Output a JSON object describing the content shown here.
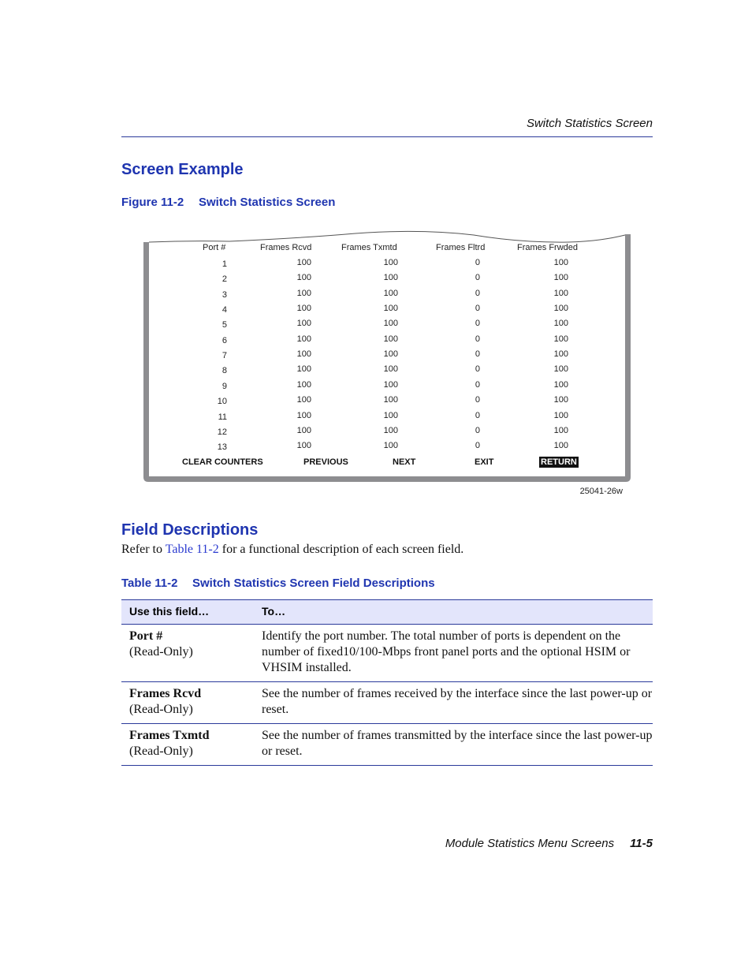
{
  "running_head": "Switch Statistics Screen",
  "section1": {
    "heading": "Screen Example",
    "figure_number": "Figure 11-2",
    "figure_title": "Switch Statistics Screen"
  },
  "screen": {
    "columns": [
      "Port #",
      "Frames Rcvd",
      "Frames Txmtd",
      "Frames Fltrd",
      "Frames Frwded"
    ],
    "rows": [
      [
        "1",
        "100",
        "100",
        "0",
        "100"
      ],
      [
        "2",
        "100",
        "100",
        "0",
        "100"
      ],
      [
        "3",
        "100",
        "100",
        "0",
        "100"
      ],
      [
        "4",
        "100",
        "100",
        "0",
        "100"
      ],
      [
        "5",
        "100",
        "100",
        "0",
        "100"
      ],
      [
        "6",
        "100",
        "100",
        "0",
        "100"
      ],
      [
        "7",
        "100",
        "100",
        "0",
        "100"
      ],
      [
        "8",
        "100",
        "100",
        "0",
        "100"
      ],
      [
        "9",
        "100",
        "100",
        "0",
        "100"
      ],
      [
        "10",
        "100",
        "100",
        "0",
        "100"
      ],
      [
        "11",
        "100",
        "100",
        "0",
        "100"
      ],
      [
        "12",
        "100",
        "100",
        "0",
        "100"
      ],
      [
        "13",
        "100",
        "100",
        "0",
        "100"
      ]
    ],
    "commands": [
      {
        "label": "CLEAR COUNTERS",
        "selected": false
      },
      {
        "label": "PREVIOUS",
        "selected": false
      },
      {
        "label": "NEXT",
        "selected": false
      },
      {
        "label": "EXIT",
        "selected": false
      },
      {
        "label": "RETURN",
        "selected": true
      }
    ],
    "figure_id": "25041-26w"
  },
  "section2": {
    "heading": "Field Descriptions",
    "para_before": "Refer to ",
    "para_link": "Table 11-2",
    "para_after": " for a functional description of each screen field.",
    "table_number": "Table 11-2",
    "table_title": "Switch Statistics Screen Field Descriptions"
  },
  "desc_table": {
    "headers": [
      "Use this field…",
      "To…"
    ],
    "rows": [
      {
        "field": "Port #",
        "note": "(Read-Only)",
        "desc": "Identify the port number. The total number of ports is dependent on the number of fixed10/100-Mbps front panel ports and the optional HSIM or VHSIM installed."
      },
      {
        "field": "Frames Rcvd",
        "note": "(Read-Only)",
        "desc": "See the number of frames received by the interface since the last power-up or reset."
      },
      {
        "field": "Frames Txmtd",
        "note": "(Read-Only)",
        "desc": "See the number of frames transmitted by the interface since the last power-up or reset."
      }
    ]
  },
  "footer": {
    "title": "Module Statistics Menu Screens",
    "page": "11-5"
  },
  "colors": {
    "heading_blue": "#1f35b0",
    "rule_blue": "#2a3a9a",
    "table_header_bg": "#e3e5fb",
    "frame_gray": "#8d8d90"
  }
}
